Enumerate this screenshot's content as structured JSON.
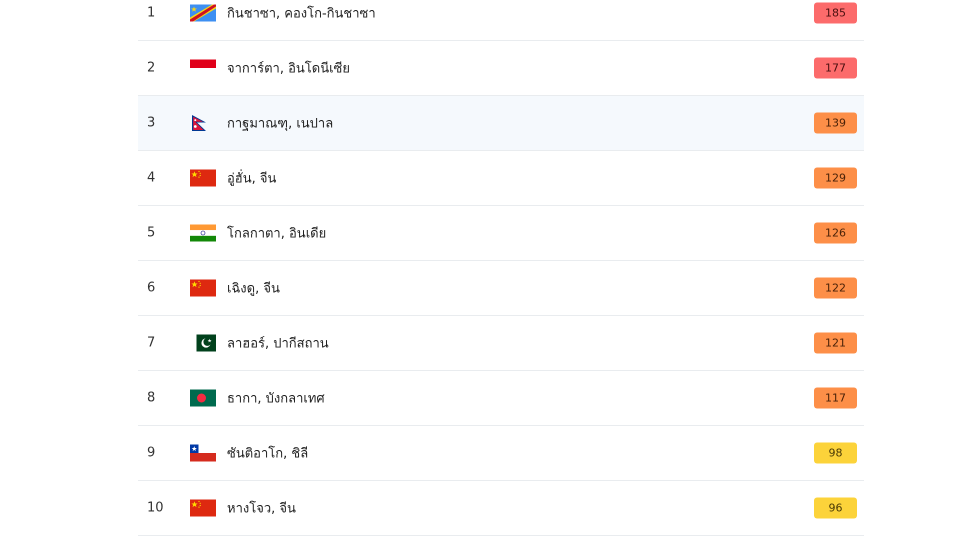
{
  "ranking": [
    {
      "rank": "1",
      "city": "กินชาซา, คองโก-กินชาซา",
      "aqi": "185",
      "flag": "dr-congo-flag-icon",
      "level": "red"
    },
    {
      "rank": "2",
      "city": "จาการ์ตา, อินโดนีเซีย",
      "aqi": "177",
      "flag": "indonesia-flag-icon",
      "level": "red"
    },
    {
      "rank": "3",
      "city": "กาฐมาณฑุ, เนปาล",
      "aqi": "139",
      "flag": "nepal-flag-icon",
      "level": "orange"
    },
    {
      "rank": "4",
      "city": "อู่ฮั่น, จีน",
      "aqi": "129",
      "flag": "china-flag-icon",
      "level": "orange"
    },
    {
      "rank": "5",
      "city": "โกลกาตา, อินเดีย",
      "aqi": "126",
      "flag": "india-flag-icon",
      "level": "orange"
    },
    {
      "rank": "6",
      "city": "เฉิงดู, จีน",
      "aqi": "122",
      "flag": "china-flag-icon",
      "level": "orange"
    },
    {
      "rank": "7",
      "city": "ลาฮอร์, ปากีสถาน",
      "aqi": "121",
      "flag": "pakistan-flag-icon",
      "level": "orange"
    },
    {
      "rank": "8",
      "city": "ธากา, บังกลาเทศ",
      "aqi": "117",
      "flag": "bangladesh-flag-icon",
      "level": "orange"
    },
    {
      "rank": "9",
      "city": "ซันติอาโก, ชิลี",
      "aqi": "98",
      "flag": "chile-flag-icon",
      "level": "yellow"
    },
    {
      "rank": "10",
      "city": "หางโจว, จีน",
      "aqi": "96",
      "flag": "china-flag-icon",
      "level": "yellow"
    }
  ],
  "colors": {
    "red": "#fc6b6b",
    "orange": "#fd8f48",
    "yellow": "#fcd33a",
    "highlight_row": "#f5f9fd"
  }
}
